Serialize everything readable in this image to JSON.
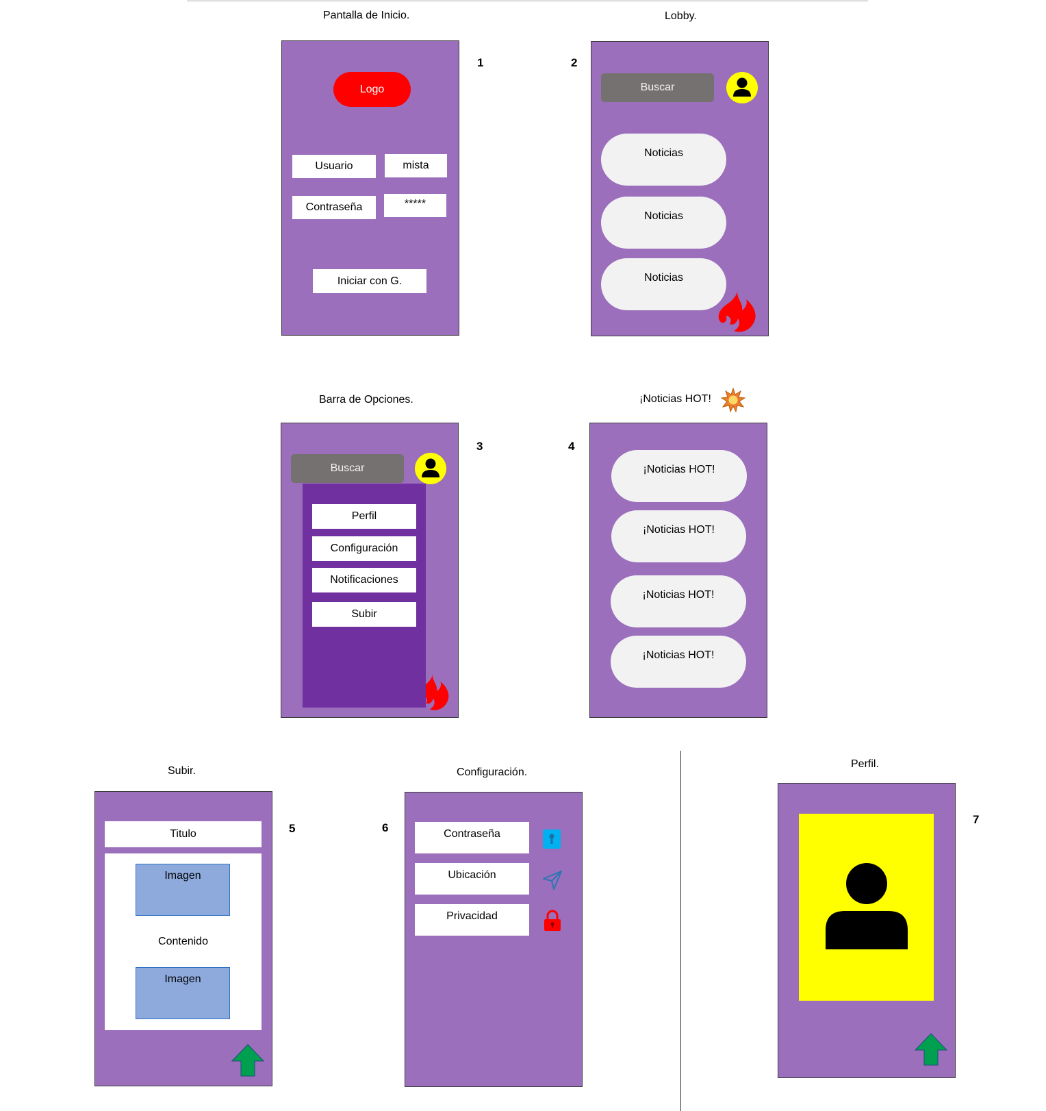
{
  "colors": {
    "screen_bg": "#9b6fbc",
    "dropdown_bg": "#7030a0",
    "logo": "#ff0000",
    "search_bg": "#767171",
    "avatar": "#ffff00",
    "pill": "#f2f2f2",
    "image_placeholder": "#8eaadc",
    "arrow": "#00a050",
    "flame": "#ff0000"
  },
  "screens": {
    "inicio": {
      "caption": "Pantalla de Inicio.",
      "number": "1",
      "logo_label": "Logo",
      "user_label": "Usuario",
      "user_value": "mista",
      "password_label": "Contraseña",
      "password_value": "*****",
      "google_button": "Iniciar con G."
    },
    "lobby": {
      "caption": "Lobby.",
      "number": "2",
      "search_label": "Buscar",
      "news": [
        "Noticias",
        "Noticias",
        "Noticias"
      ],
      "icons": [
        "user-icon",
        "flame-icon"
      ]
    },
    "opciones": {
      "caption": "Barra de Opciones.",
      "number": "3",
      "search_label": "Buscar",
      "menu": [
        "Perfil",
        "Configuración",
        "Notificaciones",
        "Subir"
      ],
      "icons": [
        "user-icon",
        "flame-icon"
      ]
    },
    "hot": {
      "caption": "¡Noticias HOT!",
      "number": "4",
      "news": [
        "¡Noticias HOT!",
        "¡Noticias HOT!",
        "¡Noticias HOT!",
        "¡Noticias HOT!"
      ],
      "icons": [
        "sun-icon"
      ]
    },
    "subir": {
      "caption": "Subir.",
      "number": "5",
      "title_label": "Titulo",
      "image_label_1": "Imagen",
      "content_label": "Contenido",
      "image_label_2": "Imagen",
      "icons": [
        "upload-arrow-icon"
      ]
    },
    "configuracion": {
      "caption": "Configuración.",
      "number": "6",
      "options": [
        "Contraseña",
        "Ubicación",
        "Privacidad"
      ],
      "icons": [
        "password-icon",
        "location-icon",
        "lock-icon"
      ]
    },
    "perfil": {
      "caption": "Perfil.",
      "number": "7",
      "icons": [
        "profile-picture-icon",
        "upload-arrow-icon"
      ]
    }
  }
}
